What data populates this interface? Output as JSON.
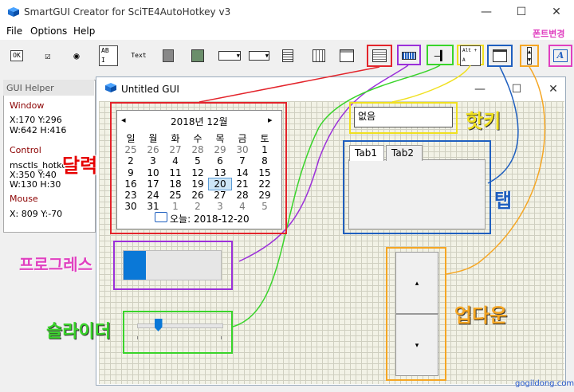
{
  "app": {
    "title": "SmartGUI Creator for SciTE4AutoHotkey v3",
    "minimize": "—",
    "maximize": "☐",
    "close": "✕"
  },
  "menu": [
    "File",
    "Options",
    "Help"
  ],
  "toolbar": {
    "ok": "OK",
    "text": "Text",
    "abi": "AB I",
    "hotkey_tool": "Alt + A",
    "font_tool": "A"
  },
  "helper": {
    "title": "GUI Helper",
    "window_label": "Window",
    "window_line1": "X:170    Y:296",
    "window_line2": "W:642    H:416",
    "control_label": "Control",
    "control_name": "msctls_hotke",
    "control_line1": "X:350    Y:40",
    "control_line2": "W:130    H:30",
    "mouse_label": "Mouse",
    "mouse_line": "X: 809  Y:-70"
  },
  "child": {
    "title": "Untitled GUI",
    "minimize": "—",
    "maximize": "☐",
    "close": "✕"
  },
  "calendar": {
    "prev": "◂",
    "next": "▸",
    "header": "2018년 12월",
    "weekdays": [
      "일",
      "월",
      "화",
      "수",
      "목",
      "금",
      "토"
    ],
    "weeks": [
      [
        "25",
        "26",
        "27",
        "28",
        "29",
        "30",
        "1"
      ],
      [
        "2",
        "3",
        "4",
        "5",
        "6",
        "7",
        "8"
      ],
      [
        "9",
        "10",
        "11",
        "12",
        "13",
        "14",
        "15"
      ],
      [
        "16",
        "17",
        "18",
        "19",
        "20",
        "21",
        "22"
      ],
      [
        "23",
        "24",
        "25",
        "26",
        "27",
        "28",
        "29"
      ],
      [
        "30",
        "31",
        "1",
        "2",
        "3",
        "4",
        "5"
      ]
    ],
    "today_text": "오늘: 2018-12-20"
  },
  "hotkey": {
    "value": "없음"
  },
  "tabs": [
    "Tab1",
    "Tab2"
  ],
  "progress": {
    "fraction": 0.23
  },
  "slider": {
    "fraction": 0.25
  },
  "updown": {
    "up": "▴",
    "down": "▾"
  },
  "annotations": {
    "calendar": "달력",
    "hotkey": "핫키",
    "tab": "탭",
    "progress": "프로그레스",
    "slider": "슬라이더",
    "updown": "업다운",
    "font": "폰트변경"
  },
  "watermark": "gogildong.com",
  "colors": {
    "red": "#e3242b",
    "purple": "#9b30d9",
    "green": "#39d42a",
    "yellow": "#f0e020",
    "blue": "#1f5fbf",
    "orange": "#f5a623",
    "magenta": "#e040c0",
    "progress_fill": "#0a78d7"
  }
}
